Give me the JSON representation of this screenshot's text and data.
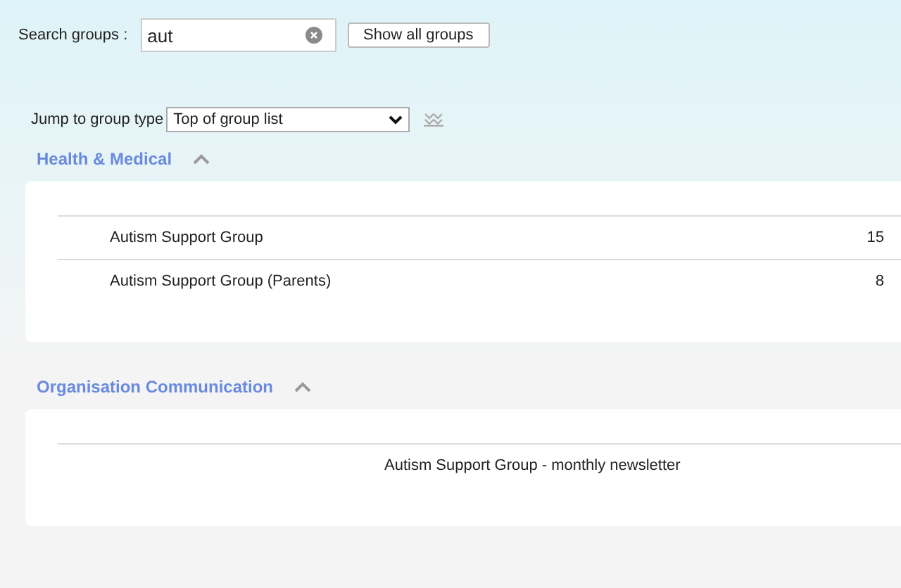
{
  "search": {
    "label": "Search groups :",
    "value": "aut",
    "button": "Show all groups"
  },
  "jump": {
    "label": "Jump to group type",
    "value": "Top of group list"
  },
  "sections": [
    {
      "title": "Health & Medical",
      "expanded": true,
      "rows": [
        {
          "name": "Autism Support Group",
          "count": "15"
        },
        {
          "name": "Autism Support Group (Parents)",
          "count": "8"
        }
      ]
    },
    {
      "title": "Organisation Communication",
      "expanded": true,
      "rows": [
        {
          "column_2": "Autism Support Group - monthly newsletter"
        }
      ]
    }
  ]
}
